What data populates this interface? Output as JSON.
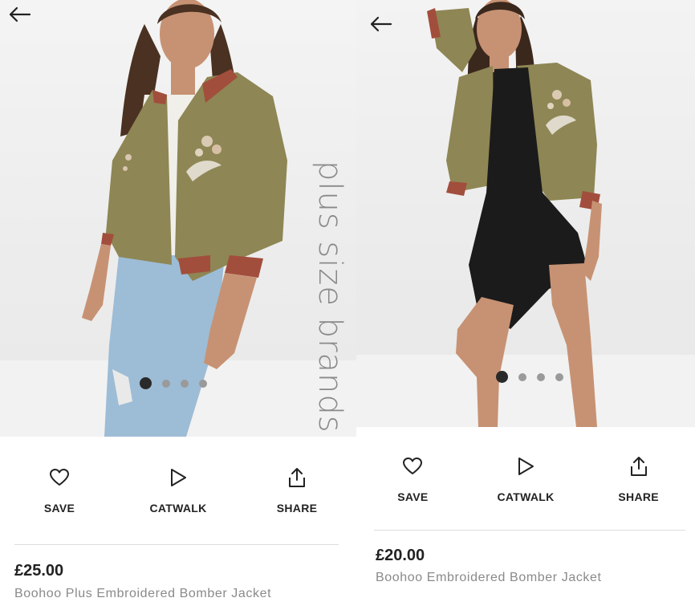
{
  "screens": [
    {
      "vertical_tag": "plus size brands",
      "carousel": {
        "total": 4,
        "active": 1
      },
      "actions": [
        {
          "label": "SAVE",
          "icon": "heart-icon"
        },
        {
          "label": "CATWALK",
          "icon": "play-icon"
        },
        {
          "label": "SHARE",
          "icon": "share-icon"
        }
      ],
      "price": "£25.00",
      "product_name": "Boohoo Plus Embroidered Bomber Jacket"
    },
    {
      "carousel": {
        "total": 4,
        "active": 1
      },
      "actions": [
        {
          "label": "SAVE",
          "icon": "heart-icon"
        },
        {
          "label": "CATWALK",
          "icon": "play-icon"
        },
        {
          "label": "SHARE",
          "icon": "share-icon"
        }
      ],
      "price": "£20.00",
      "product_name": "Boohoo Embroidered Bomber Jacket"
    }
  ],
  "colors": {
    "jacket": "#8e8654",
    "trim": "#a24e3c",
    "jeans": "#9dbcd6",
    "skin": "#c79273",
    "hair": "#4a3122",
    "dress": "#1b1b1b",
    "tee": "#f1efe9"
  }
}
